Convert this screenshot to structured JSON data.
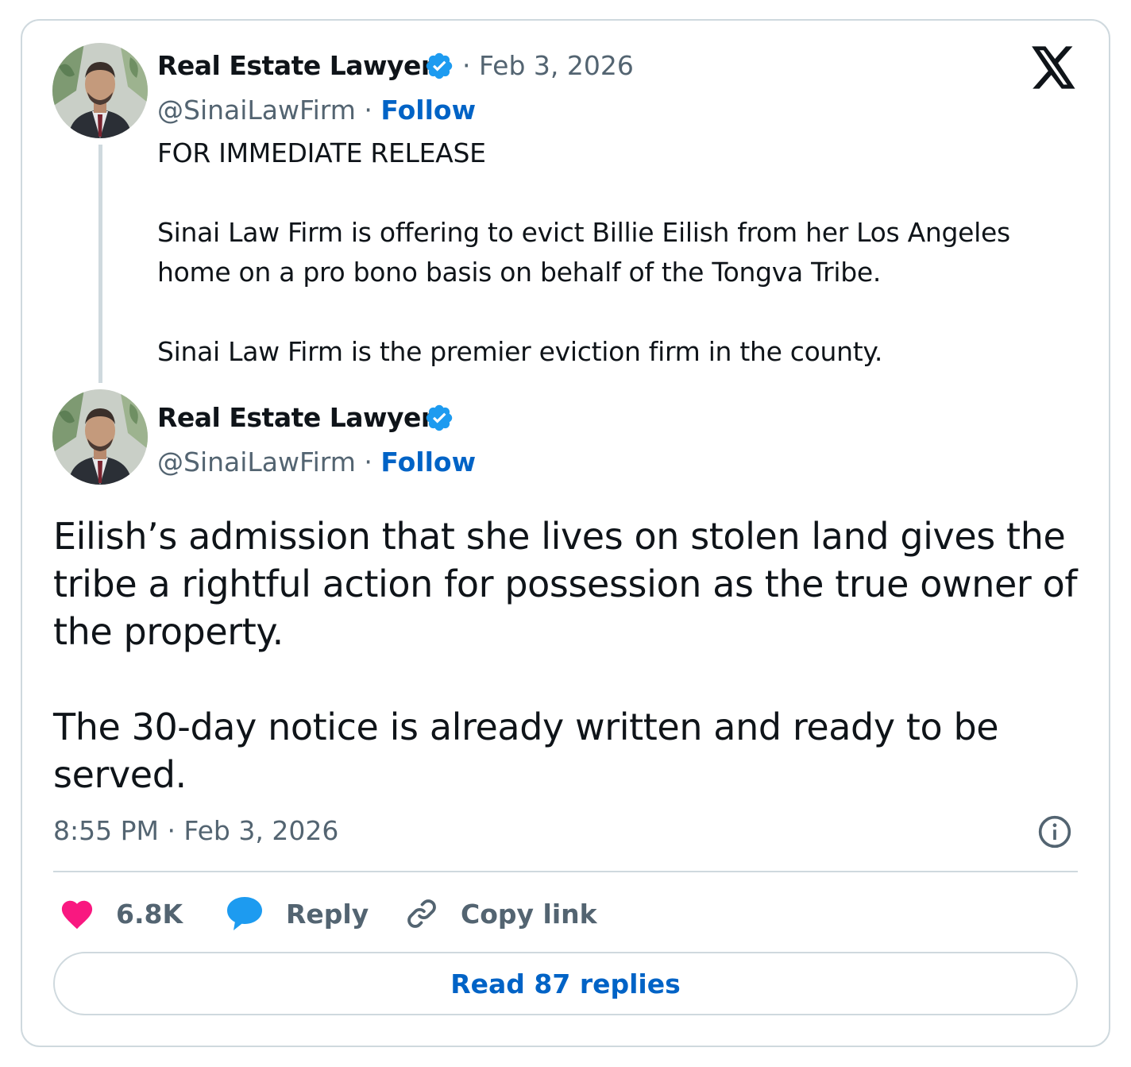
{
  "quoted_tweet": {
    "author_name": "Real Estate Lawyer",
    "date": "· Feb 3, 2026",
    "handle": "@SinaiLawFirm",
    "separator": "·",
    "follow_label": "Follow",
    "paragraphs": [
      "FOR IMMEDIATE RELEASE",
      "Sinai Law Firm is offering to evict Billie Eilish from her Los Angeles home on a pro bono basis on behalf of the Tongva Tribe.",
      "Sinai Law Firm is the premier eviction firm in the county."
    ]
  },
  "main_tweet": {
    "author_name": "Real Estate Lawyer",
    "handle": "@SinaiLawFirm",
    "separator": "·",
    "follow_label": "Follow",
    "paragraphs": [
      "Eilish’s admission that she lives on stolen land gives the tribe a rightful action for possession as the true owner of the property.",
      "The 30-day notice is already written and ready to be served."
    ],
    "timestamp": "8:55 PM · Feb 3, 2026"
  },
  "actions": {
    "like_count": "6.8K",
    "reply_label": "Reply",
    "copy_link_label": "Copy link"
  },
  "read_replies_label": "Read 87 replies",
  "icons": {
    "logo": "x-logo-icon",
    "verified": "verified-badge-icon",
    "info": "info-icon",
    "like": "heart-icon",
    "reply": "speech-bubble-icon",
    "copy": "link-icon"
  },
  "colors": {
    "accent": "#0063c6",
    "verified": "#1d9bf0",
    "like": "#f91880",
    "secondary_text": "#536471",
    "border": "#cfd9de"
  }
}
